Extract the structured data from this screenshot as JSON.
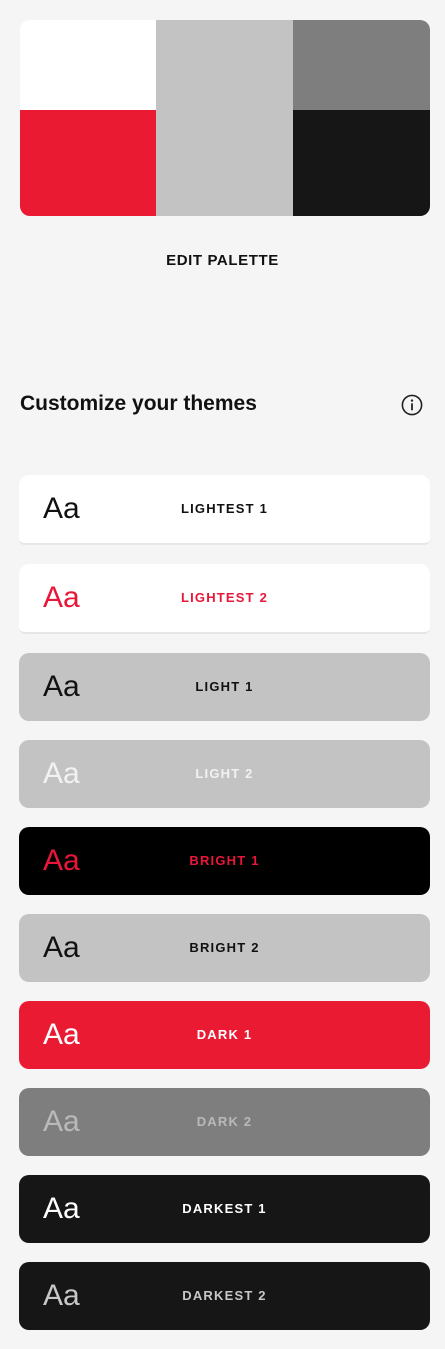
{
  "palette": {
    "swatches": [
      {
        "name": "white",
        "color": "#ffffff"
      },
      {
        "name": "red",
        "color": "#ea1a33"
      },
      {
        "name": "light-gray",
        "color": "#c3c3c3"
      },
      {
        "name": "dark-gray",
        "color": "#7e7e7e"
      },
      {
        "name": "black",
        "color": "#161616"
      }
    ],
    "edit_label": "EDIT PALETTE"
  },
  "section": {
    "title": "Customize your themes",
    "info_icon": "info-icon"
  },
  "themes": [
    {
      "sample": "Aa",
      "label": "LIGHTEST 1",
      "bg": "#ffffff",
      "sample_color": "#111111",
      "label_color": "#111111"
    },
    {
      "sample": "Aa",
      "label": "LIGHTEST 2",
      "bg": "#ffffff",
      "sample_color": "#e8173a",
      "label_color": "#e8173a"
    },
    {
      "sample": "Aa",
      "label": "LIGHT 1",
      "bg": "#c3c3c3",
      "sample_color": "#111111",
      "label_color": "#111111"
    },
    {
      "sample": "Aa",
      "label": "LIGHT 2",
      "bg": "#c3c3c3",
      "sample_color": "#f2f2f2",
      "label_color": "#f2f2f2"
    },
    {
      "sample": "Aa",
      "label": "BRIGHT 1",
      "bg": "#000000",
      "sample_color": "#e8173a",
      "label_color": "#e8173a"
    },
    {
      "sample": "Aa",
      "label": "BRIGHT 2",
      "bg": "#c3c3c3",
      "sample_color": "#111111",
      "label_color": "#111111"
    },
    {
      "sample": "Aa",
      "label": "DARK 1",
      "bg": "#ea1a33",
      "sample_color": "#ffffff",
      "label_color": "#ffffff"
    },
    {
      "sample": "Aa",
      "label": "DARK 2",
      "bg": "#7e7e7e",
      "sample_color": "#b9b9b9",
      "label_color": "#b9b9b9"
    },
    {
      "sample": "Aa",
      "label": "DARKEST 1",
      "bg": "#161616",
      "sample_color": "#ffffff",
      "label_color": "#ffffff"
    },
    {
      "sample": "Aa",
      "label": "DARKEST 2",
      "bg": "#161616",
      "sample_color": "#c7c7c7",
      "label_color": "#c7c7c7"
    }
  ]
}
